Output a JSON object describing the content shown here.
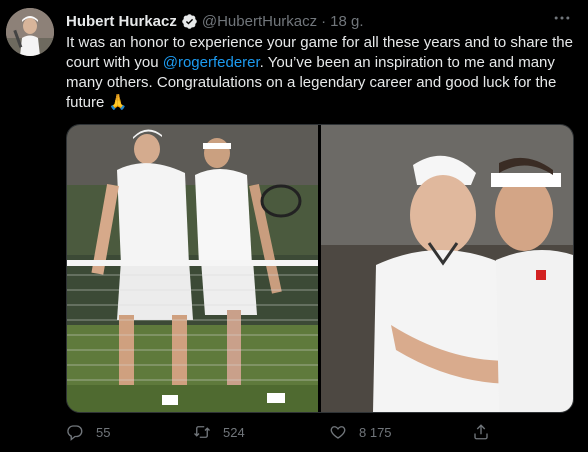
{
  "tweet": {
    "author_name": "Hubert Hurkacz",
    "author_handle": "@HubertHurkacz",
    "separator": "·",
    "timestamp": "18 g.",
    "text_part1": "It was an honor to experience your game for all these years and to share the court with you ",
    "mention": "@rogerfederer",
    "text_part2": ". You’ve been an inspiration to me and many many others. Congratulations on a legendary career and good luck for the future ",
    "emoji": "🙏"
  },
  "actions": {
    "replies": "55",
    "retweets": "524",
    "likes": "8 175"
  },
  "icons": {
    "verified": "verified-badge-icon",
    "more": "more-options-icon",
    "reply": "reply-icon",
    "retweet": "retweet-icon",
    "like": "heart-icon",
    "share": "share-icon"
  },
  "colors": {
    "background": "#000000",
    "text": "#e7e9ea",
    "muted": "#71767b",
    "accent": "#1d9bf0"
  }
}
